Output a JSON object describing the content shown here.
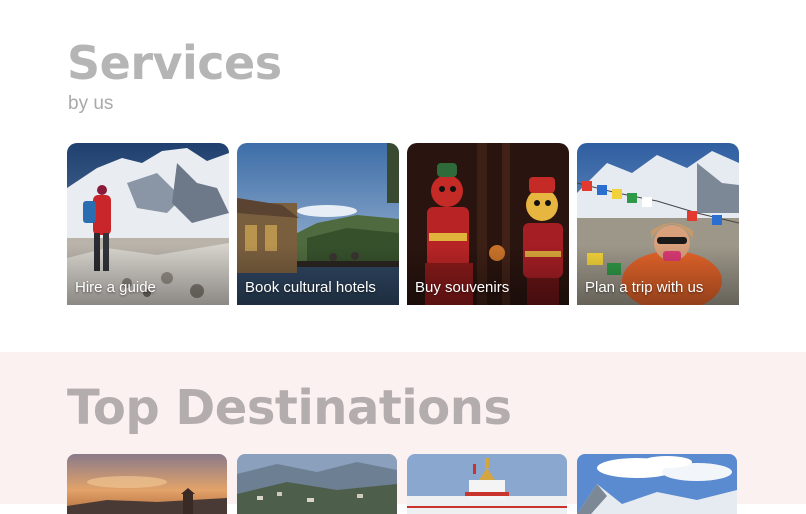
{
  "services": {
    "title": "Services",
    "subtitle": "by us",
    "cards": [
      {
        "label": "Hire a guide",
        "image": "mountain-trekker-image"
      },
      {
        "label": "Book cultural hotels",
        "image": "hotel-terrace-image"
      },
      {
        "label": "Buy souvenirs",
        "image": "puppets-image"
      },
      {
        "label": "Plan a trip with us",
        "image": "prayer-flags-traveler-image"
      }
    ]
  },
  "destinations": {
    "title": "Top Destinations",
    "cards": [
      {
        "image": "sunset-temple-image"
      },
      {
        "image": "hill-town-image"
      },
      {
        "image": "white-stupa-image"
      },
      {
        "image": "snowy-peaks-image"
      }
    ]
  }
}
